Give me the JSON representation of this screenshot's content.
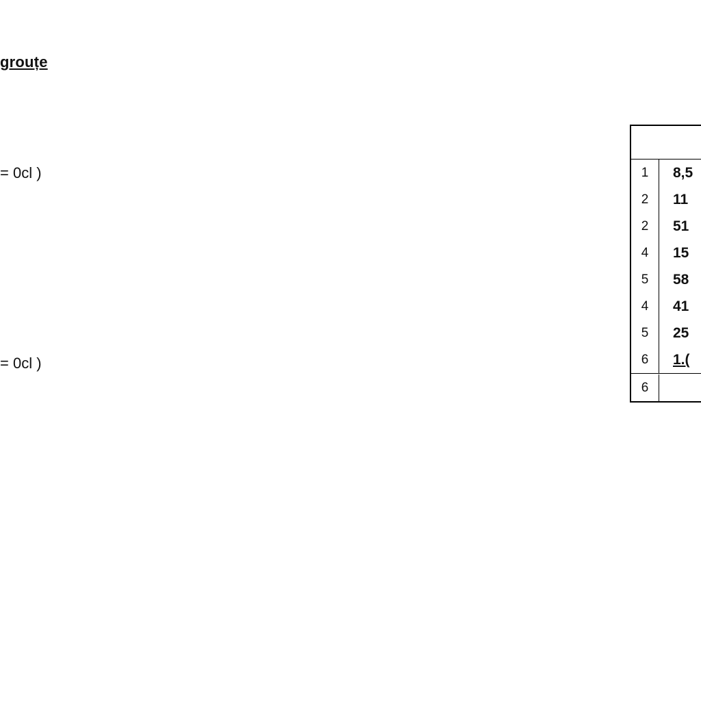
{
  "heading": "grouțe",
  "formulas": {
    "a": "= 0cl )",
    "b": "= 0cl )"
  },
  "table": {
    "rows": [
      {
        "idx": "1",
        "val": "8,5"
      },
      {
        "idx": "2",
        "val": "11"
      },
      {
        "idx": "2",
        "val": "51"
      },
      {
        "idx": "4",
        "val": "15"
      },
      {
        "idx": "5",
        "val": "58"
      },
      {
        "idx": "4",
        "val": "41"
      },
      {
        "idx": "5",
        "val": "25"
      },
      {
        "idx": "6",
        "val": "1.("
      }
    ],
    "footer_idx": "6"
  }
}
